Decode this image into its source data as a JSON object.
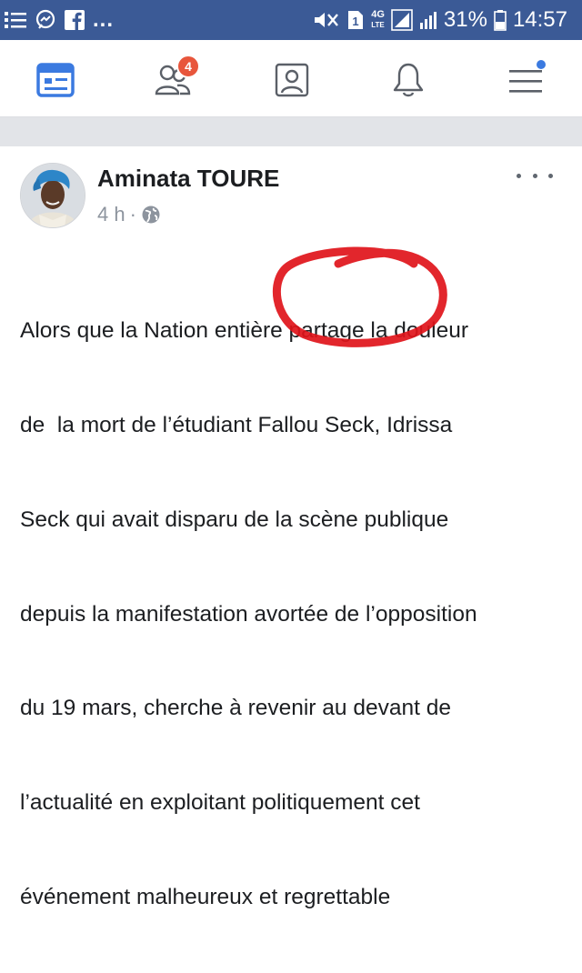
{
  "status_bar": {
    "ellipsis": "...",
    "sim_slot": "1",
    "network_type": "4G",
    "network_sub": "LTE",
    "battery_percent": "31%",
    "time": "14:57"
  },
  "nav": {
    "friend_requests_badge": "4"
  },
  "post": {
    "author": "Aminata TOURE",
    "time_ago": "4 h",
    "meta_separator": "·",
    "text_lines": [
      "Alors que la Nation entière partage la douleur",
      "de  la mort de l’étudiant Fallou Seck, Idrissa",
      "Seck qui avait disparu de la scène publique",
      "depuis la manifestation avortée de l’opposition",
      "du 19 mars, cherche à revenir au devant de",
      "l’actualité en exploitant politiquement cet",
      "événement malheureux et regrettable"
    ]
  },
  "colors": {
    "status_bar": "#3b5a96",
    "nav_active": "#3b7ae0",
    "badge": "#e8563c",
    "annotation_circle": "#e0141a"
  }
}
